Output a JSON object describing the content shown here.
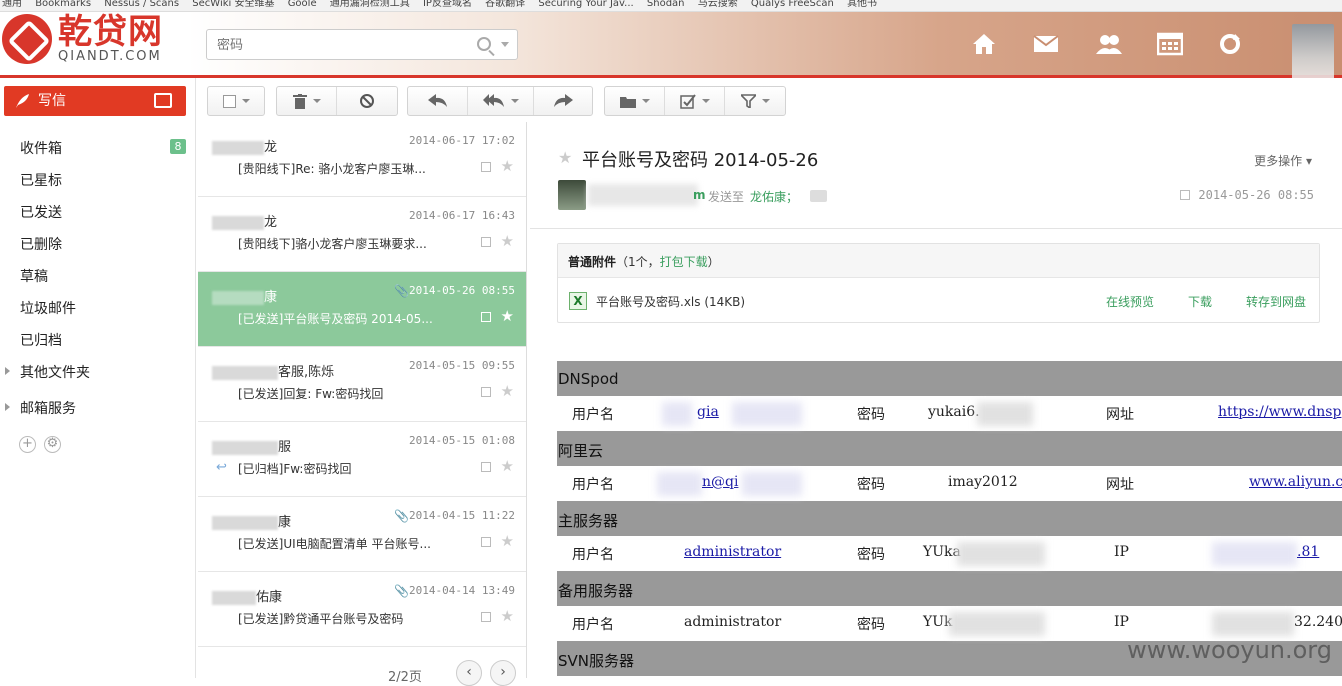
{
  "bookmarks_bar": [
    "通用",
    "Bookmarks",
    "Nessus / Scans",
    "SecWiki 安全维基",
    "Goole",
    "通用漏洞检测工具",
    "IP反查域名",
    "谷歌翻译",
    "Securing Your Jav...",
    "Shodan",
    "马云搜索",
    "Qualys FreeScan",
    "其他书"
  ],
  "header": {
    "logo_cn": "乾贷网",
    "logo_en": "QIANDT.COM",
    "search_placeholder": "密码",
    "nav_icons": [
      "home-icon",
      "mail-icon",
      "contacts-icon",
      "calendar-icon",
      "refresh-icon"
    ]
  },
  "sidebar": {
    "compose_label": "写信",
    "inbox": {
      "label": "收件箱",
      "count": "8"
    },
    "folders": [
      "已星标",
      "已发送",
      "已删除",
      "草稿",
      "垃圾邮件",
      "已归档"
    ],
    "other_folders": "其他文件夹",
    "mail_services": "邮箱服务"
  },
  "messages": [
    {
      "sender": "龙",
      "date": "2014-06-17 17:02",
      "subject": "[贵阳线下]Re: 骆小龙客户廖玉琳...",
      "attachment": false,
      "replied": false
    },
    {
      "sender": "龙",
      "date": "2014-06-17 16:43",
      "subject": "[贵阳线下]骆小龙客户廖玉琳要求...",
      "attachment": false,
      "replied": false
    },
    {
      "sender": "康",
      "date": "2014-05-26 08:55",
      "subject": "[已发送]平台账号及密码 2014-05...",
      "attachment": true,
      "replied": false,
      "selected": true
    },
    {
      "sender": "客服,陈烁",
      "date": "2014-05-15 09:55",
      "subject": "[已发送]回复: Fw:密码找回",
      "attachment": false,
      "replied": false
    },
    {
      "sender": "服",
      "date": "2014-05-15 01:08",
      "subject": "[已归档]Fw:密码找回",
      "attachment": false,
      "replied": true
    },
    {
      "sender": "康",
      "date": "2014-04-15 11:22",
      "subject": "[已发送]UI电脑配置清单 平台账号...",
      "attachment": true,
      "replied": false
    },
    {
      "sender": "佑康",
      "date": "2014-04-14 13:49",
      "subject": "[已发送]黔贷通平台账号及密码",
      "attachment": true,
      "replied": false
    }
  ],
  "pager": {
    "label": "2/2页"
  },
  "reading": {
    "title": "平台账号及密码 2014-05-26",
    "more_actions": "更多操作",
    "from_suffix": "m",
    "send_to_label": "发送至",
    "recipient": "龙佑康；",
    "date": "2014-05-26 08:55",
    "attachment_header": "普通附件",
    "attachment_count": "（1个，",
    "attachment_pack": "打包下载",
    "attachment_close": "）",
    "attachment_file": "平台账号及密码.xls (14KB)",
    "attachment_actions": [
      "在线预览",
      "下载",
      "转存到网盘"
    ]
  },
  "credentials": [
    {
      "group": "DNSpod",
      "user_label": "用户名",
      "user": "gia",
      "pwd_label": "密码",
      "pwd": "yukai6.",
      "site_label": "网址",
      "site": "https://www.dnsp"
    },
    {
      "group": "阿里云",
      "user_label": "用户名",
      "user": "n@qi",
      "pwd_label": "密码",
      "pwd": "imay2012",
      "site_label": "网址",
      "site": "www.aliyun.c"
    },
    {
      "group": "主服务器",
      "user_label": "用户名",
      "user": "administrator",
      "pwd_label": "密码",
      "pwd": "YUka",
      "site_label": "IP",
      "site": ".81"
    },
    {
      "group": "备用服务器",
      "user_label": "用户名",
      "user": "administrator",
      "pwd_label": "密码",
      "pwd": "YUk",
      "site_label": "IP",
      "site": "32.240"
    },
    {
      "group": "SVN服务器"
    }
  ],
  "watermark": "www.wooyun.org"
}
